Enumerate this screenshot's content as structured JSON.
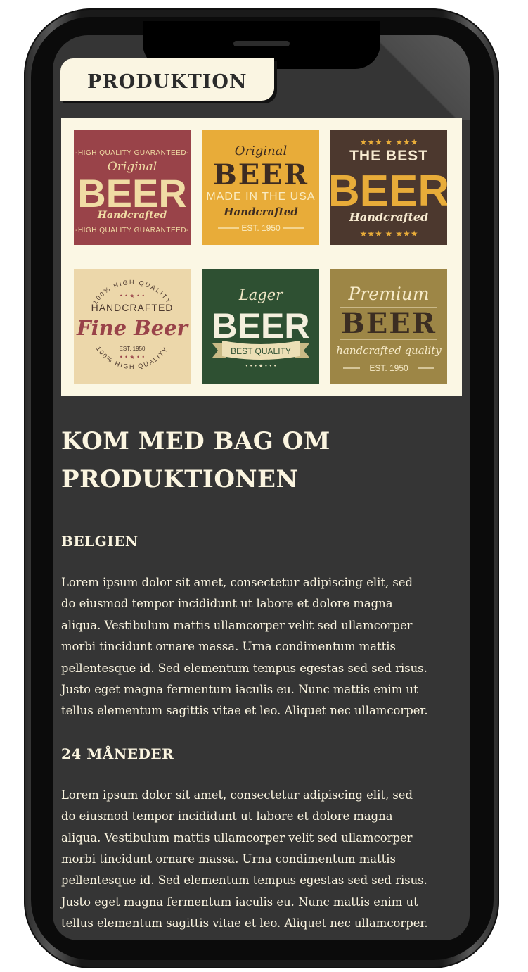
{
  "header": {
    "title": "PRODUKTION"
  },
  "labels": [
    {
      "top": "-HIGH QUALITY GUARANTEED-",
      "script": "Original",
      "main": "BEER",
      "sub": "Handcrafted",
      "bottom": "-HIGH QUALITY GUARANTEED-"
    },
    {
      "script": "Original",
      "main": "BEER",
      "line": "MADE IN THE USA",
      "sub": "Handcrafted",
      "est": "EST. 1950"
    },
    {
      "line1": "THE BEST",
      "main": "BEER",
      "sub": "Handcrafted"
    },
    {
      "ring_top": "100% HIGH QUALITY",
      "line": "HANDCRAFTED",
      "main": "Fine Beer",
      "est": "EST. 1950",
      "ring_bottom": "100% HIGH QUALITY"
    },
    {
      "script": "Lager",
      "main": "BEER",
      "ribbon": "BEST QUALITY"
    },
    {
      "script": "Premium",
      "main": "BEER",
      "sub": "handcrafted quality",
      "est": "EST. 1950"
    }
  ],
  "article": {
    "title_lines": [
      "KOM MED BAG OM",
      "PRODUKTIONEN"
    ],
    "sections": [
      {
        "heading": "BELGIEN",
        "lines": [
          "Lorem ipsum dolor sit amet, consectetur adipiscing elit, sed",
          "do eiusmod tempor incididunt ut labore et dolore magna",
          "aliqua. Vestibulum mattis ullamcorper velit sed ullamcorper",
          "morbi tincidunt ornare massa. Urna condimentum mattis",
          "pellentesque id. Sed elementum tempus egestas sed sed risus.",
          "Justo eget magna fermentum iaculis eu. Nunc mattis enim ut",
          "tellus elementum sagittis vitae et leo. Aliquet nec ullamcorper."
        ]
      },
      {
        "heading": "24 MÅNEDER",
        "lines": [
          "Lorem ipsum dolor sit amet, consectetur adipiscing elit, sed",
          "do eiusmod tempor incididunt ut labore et dolore magna",
          "aliqua. Vestibulum mattis ullamcorper velit sed ullamcorper",
          "morbi tincidunt ornare massa. Urna condimentum mattis",
          "pellentesque id. Sed elementum tempus egestas sed sed risus.",
          "Justo eget magna fermentum iaculis eu. Nunc mattis enim ut",
          "tellus elementum sagittis vitae et leo. Aliquet nec ullamcorper."
        ]
      }
    ]
  },
  "colors": {
    "screen_bg": "#353535",
    "cream": "#fbf5e0",
    "label_red": "#994349",
    "label_mustard": "#e8ac39",
    "label_brown": "#4c382e",
    "label_sand": "#ecd7aa",
    "label_green": "#2e5032",
    "label_olive": "#9d8646"
  }
}
